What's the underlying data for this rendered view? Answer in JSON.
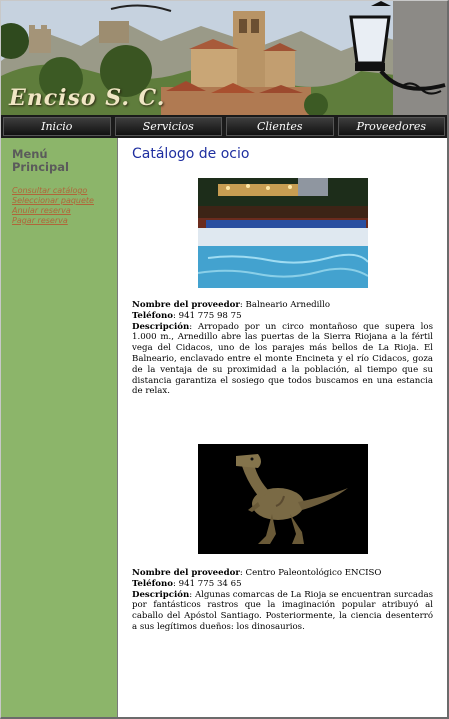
{
  "site": {
    "logo": "Enciso S. C."
  },
  "nav": {
    "items": [
      "Inicio",
      "Servicios",
      "Clientes",
      "Proveedores"
    ]
  },
  "sidebar": {
    "title": "Menú Principal",
    "links": [
      "Consultar catálogo",
      "Seleccionar paquete",
      "Anular reserva",
      "Pagar reserva"
    ]
  },
  "main": {
    "title": "Catálogo de ocio",
    "labels": {
      "provider": "Nombre del proveedor",
      "phone": "Teléfono",
      "description": "Descripción"
    },
    "entries": [
      {
        "provider": "Balneario Arnedillo",
        "phone": "941 775 98 75",
        "description": "Arropado por un circo montañoso que supera los 1.000 m., Arnedillo abre las puertas de la Sierra Riojana a la fértil vega del Cidacos, uno de los parajes más bellos de La Rioja. El Balneario, enclavado entre el monte Encineta y el río Cidacos, goza de la ventaja de su proximidad a la población, al tiempo que su distancia garantiza el sosiego que todos buscamos en una estancia de relax.",
        "image": "pool-photo"
      },
      {
        "provider": "Centro Paleontológico ENCISO",
        "phone": "941 775 34 65",
        "description": "Algunas comarcas de La Rioja se encuentran surcadas por fantásticos rastros que la imaginación popular atribuyó al caballo del Apóstol Santiago. Posteriormente, la ciencia desenterró a sus legítimos dueños: los dinosaurios.",
        "image": "dinosaur-photo"
      }
    ]
  },
  "colors": {
    "sidebar": "#8cb56a",
    "title": "#1f2fa0",
    "link": "#b0663a",
    "nav": "#1a1a1a"
  }
}
